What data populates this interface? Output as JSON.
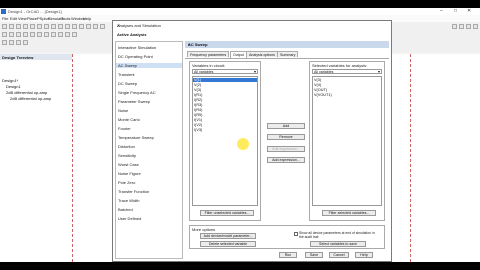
{
  "app": {
    "title": "Design1 - OrCAD ... [Design1]",
    "menu": [
      "File",
      "Edit",
      "View",
      "Place",
      "PSpice",
      "Simulate",
      "Tools",
      "Window",
      "Help"
    ]
  },
  "design_tree": {
    "header": "Design Treeview",
    "items": [
      "Design1*",
      "Design1",
      "2dB differential op-amp",
      "2dB differential op-amp"
    ]
  },
  "dialog": {
    "title": "Analyses and Simulation",
    "subtitle": "Active Analysis",
    "analyses": [
      "Interactive Simulation",
      "DC Operating Point",
      "AC Sweep",
      "Transient",
      "DC Sweep",
      "Single Frequency AC",
      "Parameter Sweep",
      "Noise",
      "Monte Carlo",
      "Fourier",
      "Temperature Sweep",
      "Distortion",
      "Sensitivity",
      "Worst Case",
      "Noise Figure",
      "Pole Zero",
      "Transfer Function",
      "Trace Width",
      "Batched",
      "User Defined"
    ],
    "selected_analysis": "AC Sweep",
    "pane_title": "AC Sweep",
    "tabs": [
      "Frequency parameters",
      "Output",
      "Analysis options",
      "Summary"
    ],
    "active_tab": "Output",
    "variables_in_circuit_label": "Variables in circuit:",
    "variables_filter": "All variables",
    "variables": [
      "V(1)",
      "V(2)",
      "V(3)",
      "I(R1)",
      "I(R2)",
      "I(R3)",
      "I(R4)",
      "I(R5)",
      "I(V1)",
      "I(V2)",
      "I(V3)"
    ],
    "selected_variables_label": "Selected variables for analysis:",
    "selected_filter": "All variables",
    "selected_variables": [
      "V(3)",
      "V(4)",
      "V(OUT)",
      "V(VOUT1)"
    ],
    "buttons": {
      "add": "Add",
      "remove": "Remove",
      "edit_expression": "Edit expression...",
      "add_expression": "Add expression...",
      "filter_unselected": "Filter unselected variables...",
      "filter_selected": "Filter selected variables...",
      "add_device_param": "Add device/model parameter...",
      "delete_selected_var": "Delete selected variable",
      "select_vars_to_save": "Select variables to save",
      "run": "Run",
      "save": "Save",
      "cancel": "Cancel",
      "help": "Help"
    },
    "more_options_label": "More options",
    "show_all_params_text": "Show all device parameters at end of simulation in the audit trail"
  }
}
